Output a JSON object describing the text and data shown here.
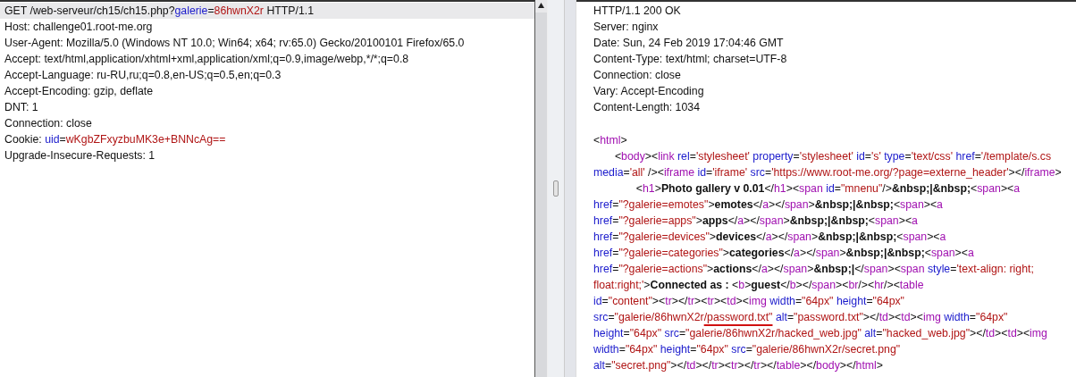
{
  "request": {
    "lines": [
      {
        "selected": true,
        "tokens": [
          {
            "kind": "plain",
            "text": "GET /web-serveur/ch15/ch15.php?"
          },
          {
            "kind": "attr",
            "text": "galerie"
          },
          {
            "kind": "plain",
            "text": "="
          },
          {
            "kind": "value",
            "text": "86hwnX2r"
          },
          {
            "kind": "plain",
            "text": " HTTP/1.1"
          }
        ]
      },
      {
        "selected": false,
        "tokens": [
          {
            "kind": "plain",
            "text": "Host: challenge01.root-me.org"
          }
        ]
      },
      {
        "selected": false,
        "tokens": [
          {
            "kind": "plain",
            "text": "User-Agent: Mozilla/5.0 (Windows NT 10.0; Win64; x64; rv:65.0) Gecko/20100101 Firefox/65.0"
          }
        ]
      },
      {
        "selected": false,
        "tokens": [
          {
            "kind": "plain",
            "text": "Accept: text/html,application/xhtml+xml,application/xml;q=0.9,image/webp,*/*;q=0.8"
          }
        ]
      },
      {
        "selected": false,
        "tokens": [
          {
            "kind": "plain",
            "text": "Accept-Language: ru-RU,ru;q=0.8,en-US;q=0.5,en;q=0.3"
          }
        ]
      },
      {
        "selected": false,
        "tokens": [
          {
            "kind": "plain",
            "text": "Accept-Encoding: gzip, deflate"
          }
        ]
      },
      {
        "selected": false,
        "tokens": [
          {
            "kind": "plain",
            "text": "DNT: 1"
          }
        ]
      },
      {
        "selected": false,
        "tokens": [
          {
            "kind": "plain",
            "text": "Connection: close"
          }
        ]
      },
      {
        "selected": false,
        "tokens": [
          {
            "kind": "plain",
            "text": "Cookie: "
          },
          {
            "kind": "attr",
            "text": "uid"
          },
          {
            "kind": "plain",
            "text": "="
          },
          {
            "kind": "value",
            "text": "wKgbZFxyzbuMK3e+BNNcAg=="
          }
        ]
      },
      {
        "selected": false,
        "tokens": [
          {
            "kind": "plain",
            "text": "Upgrade-Insecure-Requests: 1"
          }
        ]
      }
    ]
  },
  "response": {
    "headers": [
      {
        "tokens": [
          {
            "kind": "plain",
            "text": "HTTP/1.1 200 OK"
          }
        ]
      },
      {
        "tokens": [
          {
            "kind": "plain",
            "text": "Server: nginx"
          }
        ]
      },
      {
        "tokens": [
          {
            "kind": "plain",
            "text": "Date: Sun, 24 Feb 2019 17:04:46 GMT"
          }
        ]
      },
      {
        "tokens": [
          {
            "kind": "plain",
            "text": "Content-Type: text/html; charset=UTF-8"
          }
        ]
      },
      {
        "tokens": [
          {
            "kind": "plain",
            "text": "Connection: close"
          }
        ]
      },
      {
        "tokens": [
          {
            "kind": "plain",
            "text": "Vary: Accept-Encoding"
          }
        ]
      },
      {
        "tokens": [
          {
            "kind": "plain",
            "text": "Content-Length: 1034"
          }
        ]
      }
    ],
    "body": [
      {
        "tokens": [
          {
            "kind": "plain",
            "text": "<"
          },
          {
            "kind": "tag",
            "text": "html"
          },
          {
            "kind": "plain",
            "text": ">"
          }
        ]
      },
      {
        "tokens": [
          {
            "kind": "plain",
            "text": "\t<"
          },
          {
            "kind": "tag",
            "text": "body"
          },
          {
            "kind": "plain",
            "text": "><"
          },
          {
            "kind": "tag",
            "text": "link"
          },
          {
            "kind": "attr",
            "text": " rel"
          },
          {
            "kind": "plain",
            "text": "="
          },
          {
            "kind": "value",
            "text": "'stylesheet'"
          },
          {
            "kind": "attr",
            "text": " property"
          },
          {
            "kind": "plain",
            "text": "="
          },
          {
            "kind": "value",
            "text": "'stylesheet'"
          },
          {
            "kind": "attr",
            "text": " id"
          },
          {
            "kind": "plain",
            "text": "="
          },
          {
            "kind": "value",
            "text": "'s'"
          },
          {
            "kind": "attr",
            "text": " type"
          },
          {
            "kind": "plain",
            "text": "="
          },
          {
            "kind": "value",
            "text": "'text/css'"
          },
          {
            "kind": "attr",
            "text": " href"
          },
          {
            "kind": "plain",
            "text": "="
          },
          {
            "kind": "value",
            "text": "'/template/s.cs"
          }
        ]
      },
      {
        "tokens": [
          {
            "kind": "attr",
            "text": "media"
          },
          {
            "kind": "plain",
            "text": "="
          },
          {
            "kind": "value",
            "text": "'all'"
          },
          {
            "kind": "plain",
            "text": " /><"
          },
          {
            "kind": "tag",
            "text": "iframe"
          },
          {
            "kind": "attr",
            "text": " id"
          },
          {
            "kind": "plain",
            "text": "="
          },
          {
            "kind": "value",
            "text": "'iframe'"
          },
          {
            "kind": "attr",
            "text": " src"
          },
          {
            "kind": "plain",
            "text": "="
          },
          {
            "kind": "value",
            "text": "'https://www.root-me.org/?page=externe_header'"
          },
          {
            "kind": "plain",
            "text": "></"
          },
          {
            "kind": "tag",
            "text": "iframe"
          },
          {
            "kind": "plain",
            "text": ">"
          }
        ]
      },
      {
        "tokens": [
          {
            "kind": "plain",
            "text": "\t\t<"
          },
          {
            "kind": "tag",
            "text": "h1"
          },
          {
            "kind": "plain",
            "text": ">"
          },
          {
            "kind": "bold",
            "text": "Photo gallery v 0.01"
          },
          {
            "kind": "plain",
            "text": "</"
          },
          {
            "kind": "tag",
            "text": "h1"
          },
          {
            "kind": "plain",
            "text": "><"
          },
          {
            "kind": "tag",
            "text": "span"
          },
          {
            "kind": "attr",
            "text": " id"
          },
          {
            "kind": "plain",
            "text": "="
          },
          {
            "kind": "value",
            "text": "\"mnenu\""
          },
          {
            "kind": "plain",
            "text": "/>"
          },
          {
            "kind": "bold",
            "text": "&nbsp;|&nbsp;"
          },
          {
            "kind": "plain",
            "text": "<"
          },
          {
            "kind": "tag",
            "text": "span"
          },
          {
            "kind": "plain",
            "text": "><"
          },
          {
            "kind": "tag",
            "text": "a"
          }
        ]
      },
      {
        "tokens": [
          {
            "kind": "attr",
            "text": "href"
          },
          {
            "kind": "plain",
            "text": "="
          },
          {
            "kind": "value",
            "text": "\"?galerie=emotes\""
          },
          {
            "kind": "plain",
            "text": ">"
          },
          {
            "kind": "bold",
            "text": "emotes"
          },
          {
            "kind": "plain",
            "text": "</"
          },
          {
            "kind": "tag",
            "text": "a"
          },
          {
            "kind": "plain",
            "text": "></"
          },
          {
            "kind": "tag",
            "text": "span"
          },
          {
            "kind": "plain",
            "text": ">"
          },
          {
            "kind": "bold",
            "text": "&nbsp;|&nbsp;"
          },
          {
            "kind": "plain",
            "text": "<"
          },
          {
            "kind": "tag",
            "text": "span"
          },
          {
            "kind": "plain",
            "text": "><"
          },
          {
            "kind": "tag",
            "text": "a"
          }
        ]
      },
      {
        "tokens": [
          {
            "kind": "attr",
            "text": "href"
          },
          {
            "kind": "plain",
            "text": "="
          },
          {
            "kind": "value",
            "text": "\"?galerie=apps\""
          },
          {
            "kind": "plain",
            "text": ">"
          },
          {
            "kind": "bold",
            "text": "apps"
          },
          {
            "kind": "plain",
            "text": "</"
          },
          {
            "kind": "tag",
            "text": "a"
          },
          {
            "kind": "plain",
            "text": "></"
          },
          {
            "kind": "tag",
            "text": "span"
          },
          {
            "kind": "plain",
            "text": ">"
          },
          {
            "kind": "bold",
            "text": "&nbsp;|&nbsp;"
          },
          {
            "kind": "plain",
            "text": "<"
          },
          {
            "kind": "tag",
            "text": "span"
          },
          {
            "kind": "plain",
            "text": "><"
          },
          {
            "kind": "tag",
            "text": "a"
          }
        ]
      },
      {
        "tokens": [
          {
            "kind": "attr",
            "text": "href"
          },
          {
            "kind": "plain",
            "text": "="
          },
          {
            "kind": "value",
            "text": "\"?galerie=devices\""
          },
          {
            "kind": "plain",
            "text": ">"
          },
          {
            "kind": "bold",
            "text": "devices"
          },
          {
            "kind": "plain",
            "text": "</"
          },
          {
            "kind": "tag",
            "text": "a"
          },
          {
            "kind": "plain",
            "text": "></"
          },
          {
            "kind": "tag",
            "text": "span"
          },
          {
            "kind": "plain",
            "text": ">"
          },
          {
            "kind": "bold",
            "text": "&nbsp;|&nbsp;"
          },
          {
            "kind": "plain",
            "text": "<"
          },
          {
            "kind": "tag",
            "text": "span"
          },
          {
            "kind": "plain",
            "text": "><"
          },
          {
            "kind": "tag",
            "text": "a"
          }
        ]
      },
      {
        "tokens": [
          {
            "kind": "attr",
            "text": "href"
          },
          {
            "kind": "plain",
            "text": "="
          },
          {
            "kind": "value",
            "text": "\"?galerie=categories\""
          },
          {
            "kind": "plain",
            "text": ">"
          },
          {
            "kind": "bold",
            "text": "categories"
          },
          {
            "kind": "plain",
            "text": "</"
          },
          {
            "kind": "tag",
            "text": "a"
          },
          {
            "kind": "plain",
            "text": "></"
          },
          {
            "kind": "tag",
            "text": "span"
          },
          {
            "kind": "plain",
            "text": ">"
          },
          {
            "kind": "bold",
            "text": "&nbsp;|&nbsp;"
          },
          {
            "kind": "plain",
            "text": "<"
          },
          {
            "kind": "tag",
            "text": "span"
          },
          {
            "kind": "plain",
            "text": "><"
          },
          {
            "kind": "tag",
            "text": "a"
          }
        ]
      },
      {
        "tokens": [
          {
            "kind": "attr",
            "text": "href"
          },
          {
            "kind": "plain",
            "text": "="
          },
          {
            "kind": "value",
            "text": "\"?galerie=actions\""
          },
          {
            "kind": "plain",
            "text": ">"
          },
          {
            "kind": "bold",
            "text": "actions"
          },
          {
            "kind": "plain",
            "text": "</"
          },
          {
            "kind": "tag",
            "text": "a"
          },
          {
            "kind": "plain",
            "text": "></"
          },
          {
            "kind": "tag",
            "text": "span"
          },
          {
            "kind": "plain",
            "text": ">"
          },
          {
            "kind": "bold",
            "text": "&nbsp;|"
          },
          {
            "kind": "plain",
            "text": "</"
          },
          {
            "kind": "tag",
            "text": "span"
          },
          {
            "kind": "plain",
            "text": "><"
          },
          {
            "kind": "tag",
            "text": "span"
          },
          {
            "kind": "attr",
            "text": " style"
          },
          {
            "kind": "plain",
            "text": "="
          },
          {
            "kind": "value",
            "text": "'text-align: right;"
          }
        ]
      },
      {
        "tokens": [
          {
            "kind": "value",
            "text": "float:right;'"
          },
          {
            "kind": "plain",
            "text": ">"
          },
          {
            "kind": "bold",
            "text": "Connected as : "
          },
          {
            "kind": "plain",
            "text": "<"
          },
          {
            "kind": "tag",
            "text": "b"
          },
          {
            "kind": "plain",
            "text": ">"
          },
          {
            "kind": "bold",
            "text": "guest"
          },
          {
            "kind": "plain",
            "text": "</"
          },
          {
            "kind": "tag",
            "text": "b"
          },
          {
            "kind": "plain",
            "text": "></"
          },
          {
            "kind": "tag",
            "text": "span"
          },
          {
            "kind": "plain",
            "text": "><"
          },
          {
            "kind": "tag",
            "text": "br"
          },
          {
            "kind": "plain",
            "text": "/><"
          },
          {
            "kind": "tag",
            "text": "hr"
          },
          {
            "kind": "plain",
            "text": "/><"
          },
          {
            "kind": "tag",
            "text": "table"
          }
        ]
      },
      {
        "tokens": [
          {
            "kind": "attr",
            "text": "id"
          },
          {
            "kind": "plain",
            "text": "="
          },
          {
            "kind": "value",
            "text": "\"content\""
          },
          {
            "kind": "plain",
            "text": "><"
          },
          {
            "kind": "tag",
            "text": "tr"
          },
          {
            "kind": "plain",
            "text": "></"
          },
          {
            "kind": "tag",
            "text": "tr"
          },
          {
            "kind": "plain",
            "text": "><"
          },
          {
            "kind": "tag",
            "text": "tr"
          },
          {
            "kind": "plain",
            "text": "><"
          },
          {
            "kind": "tag",
            "text": "td"
          },
          {
            "kind": "plain",
            "text": "><"
          },
          {
            "kind": "tag",
            "text": "img"
          },
          {
            "kind": "attr",
            "text": " width"
          },
          {
            "kind": "plain",
            "text": "="
          },
          {
            "kind": "value",
            "text": "\"64px\""
          },
          {
            "kind": "attr",
            "text": " height"
          },
          {
            "kind": "plain",
            "text": "="
          },
          {
            "kind": "value",
            "text": "\"64px\""
          }
        ]
      },
      {
        "tokens": [
          {
            "kind": "attr",
            "text": "src"
          },
          {
            "kind": "plain",
            "text": "="
          },
          {
            "kind": "value",
            "text": "\"galerie/86hwnX2r"
          },
          {
            "kind": "marked",
            "text": "/password.txt\""
          },
          {
            "kind": "attr",
            "text": " alt"
          },
          {
            "kind": "plain",
            "text": "="
          },
          {
            "kind": "value",
            "text": "\"password.txt\""
          },
          {
            "kind": "plain",
            "text": "></"
          },
          {
            "kind": "tag",
            "text": "td"
          },
          {
            "kind": "plain",
            "text": "><"
          },
          {
            "kind": "tag",
            "text": "td"
          },
          {
            "kind": "plain",
            "text": "><"
          },
          {
            "kind": "tag",
            "text": "img"
          },
          {
            "kind": "attr",
            "text": " width"
          },
          {
            "kind": "plain",
            "text": "="
          },
          {
            "kind": "value",
            "text": "\"64px\""
          }
        ]
      },
      {
        "tokens": [
          {
            "kind": "attr",
            "text": "height"
          },
          {
            "kind": "plain",
            "text": "="
          },
          {
            "kind": "value",
            "text": "\"64px\""
          },
          {
            "kind": "attr",
            "text": " src"
          },
          {
            "kind": "plain",
            "text": "="
          },
          {
            "kind": "value",
            "text": "\"galerie/86hwnX2r/hacked_web.jpg\""
          },
          {
            "kind": "attr",
            "text": " alt"
          },
          {
            "kind": "plain",
            "text": "="
          },
          {
            "kind": "value",
            "text": "\"hacked_web.jpg\""
          },
          {
            "kind": "plain",
            "text": "></"
          },
          {
            "kind": "tag",
            "text": "td"
          },
          {
            "kind": "plain",
            "text": "><"
          },
          {
            "kind": "tag",
            "text": "td"
          },
          {
            "kind": "plain",
            "text": "><"
          },
          {
            "kind": "tag",
            "text": "img"
          }
        ]
      },
      {
        "tokens": [
          {
            "kind": "attr",
            "text": "width"
          },
          {
            "kind": "plain",
            "text": "="
          },
          {
            "kind": "value",
            "text": "\"64px\""
          },
          {
            "kind": "attr",
            "text": " height"
          },
          {
            "kind": "plain",
            "text": "="
          },
          {
            "kind": "value",
            "text": "\"64px\""
          },
          {
            "kind": "attr",
            "text": " src"
          },
          {
            "kind": "plain",
            "text": "="
          },
          {
            "kind": "value",
            "text": "\"galerie/86hwnX2r/secret.png\""
          }
        ]
      },
      {
        "tokens": [
          {
            "kind": "attr",
            "text": "alt"
          },
          {
            "kind": "plain",
            "text": "="
          },
          {
            "kind": "value",
            "text": "\"secret.png\""
          },
          {
            "kind": "plain",
            "text": "></"
          },
          {
            "kind": "tag",
            "text": "td"
          },
          {
            "kind": "plain",
            "text": "></"
          },
          {
            "kind": "tag",
            "text": "tr"
          },
          {
            "kind": "plain",
            "text": "><"
          },
          {
            "kind": "tag",
            "text": "tr"
          },
          {
            "kind": "plain",
            "text": "></"
          },
          {
            "kind": "tag",
            "text": "tr"
          },
          {
            "kind": "plain",
            "text": "></"
          },
          {
            "kind": "tag",
            "text": "table"
          },
          {
            "kind": "plain",
            "text": "></"
          },
          {
            "kind": "tag",
            "text": "body"
          },
          {
            "kind": "plain",
            "text": "></"
          },
          {
            "kind": "tag",
            "text": "html"
          },
          {
            "kind": "plain",
            "text": ">"
          }
        ]
      }
    ]
  }
}
